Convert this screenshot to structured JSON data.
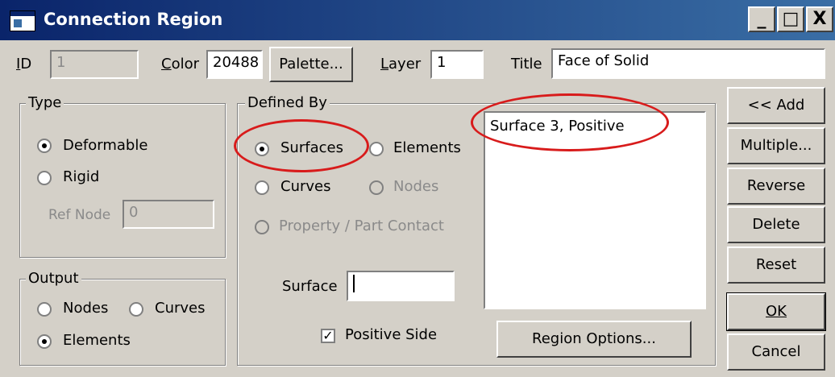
{
  "window": {
    "title": "Connection Region"
  },
  "titlebar_buttons": {
    "minimize": "_",
    "maximize": "□",
    "close": "X"
  },
  "id_field": {
    "label": "ID",
    "value": "1"
  },
  "color_field": {
    "label": "Color",
    "value": "20488"
  },
  "palette_button": "Palette...",
  "layer_field": {
    "label": "Layer",
    "value": "1"
  },
  "title_field": {
    "label": "Title",
    "value": "Face of Solid"
  },
  "type_group": {
    "title": "Type",
    "deformable": "Deformable",
    "rigid": "Rigid",
    "ref_node_label": "Ref Node",
    "ref_node_value": "0"
  },
  "output_group": {
    "title": "Output",
    "nodes": "Nodes",
    "curves": "Curves",
    "elements": "Elements"
  },
  "defined_by_group": {
    "title": "Defined By",
    "surfaces": "Surfaces",
    "elements": "Elements",
    "curves": "Curves",
    "nodes": "Nodes",
    "property_part_contact": "Property / Part Contact",
    "surface_label": "Surface",
    "surface_value": "",
    "positive_side": "Positive Side"
  },
  "region_list": {
    "items": [
      "Surface 3, Positive"
    ]
  },
  "region_options_button": "Region Options...",
  "side_buttons": {
    "add": "<< Add",
    "multiple": "Multiple...",
    "reverse": "Reverse",
    "delete": "Delete",
    "reset": "Reset",
    "ok": "OK",
    "cancel": "Cancel"
  },
  "colors": {
    "titlebar_start": "#0a246a",
    "titlebar_end": "#3a6ea5",
    "highlight_ellipse": "#d81b1b",
    "dialog_bg": "#d4d0c8"
  }
}
